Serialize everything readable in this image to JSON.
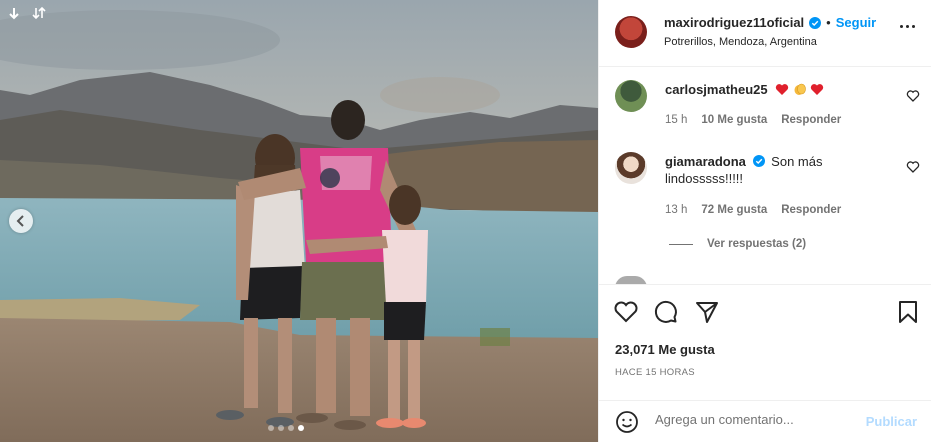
{
  "post": {
    "username": "maxirodriguez11oficial",
    "separator": "•",
    "follow_label": "Seguir",
    "location": "Potrerillos, Mendoza, Argentina",
    "icons": {
      "avatar": "profile-avatar",
      "verified": "verified-badge-icon",
      "more": "more-options-icon"
    }
  },
  "photo": {
    "description_icons": [
      "multiple-photos-icon",
      "expand-icon",
      "chevron-left-icon"
    ],
    "carousel_count": 4,
    "carousel_active": 4
  },
  "comments": [
    {
      "username": "carlosjmatheu25",
      "text": "",
      "emoji": [
        "heart",
        "clapping-hands",
        "heart"
      ],
      "time": "15 h",
      "likes": "10 Me gusta",
      "reply_label": "Responder"
    },
    {
      "username": "giamaradona",
      "verified": true,
      "text": "Son más lindosssss!!!!!",
      "time": "13 h",
      "likes": "72 Me gusta",
      "reply_label": "Responder"
    }
  ],
  "view_replies_label": "Ver respuestas (2)",
  "actions": {
    "icons": [
      "heart-icon",
      "comment-icon",
      "share-icon",
      "bookmark-icon"
    ],
    "likes_text": "23,071 Me gusta",
    "time_text": "HACE 15 HORAS"
  },
  "add_comment": {
    "placeholder": "Agrega un comentario...",
    "publish_label": "Publicar"
  },
  "colors": {
    "accent": "#0095f6",
    "heart_red": "#ed4956",
    "muted": "#737373",
    "publish_disabled": "#b3dbff"
  }
}
